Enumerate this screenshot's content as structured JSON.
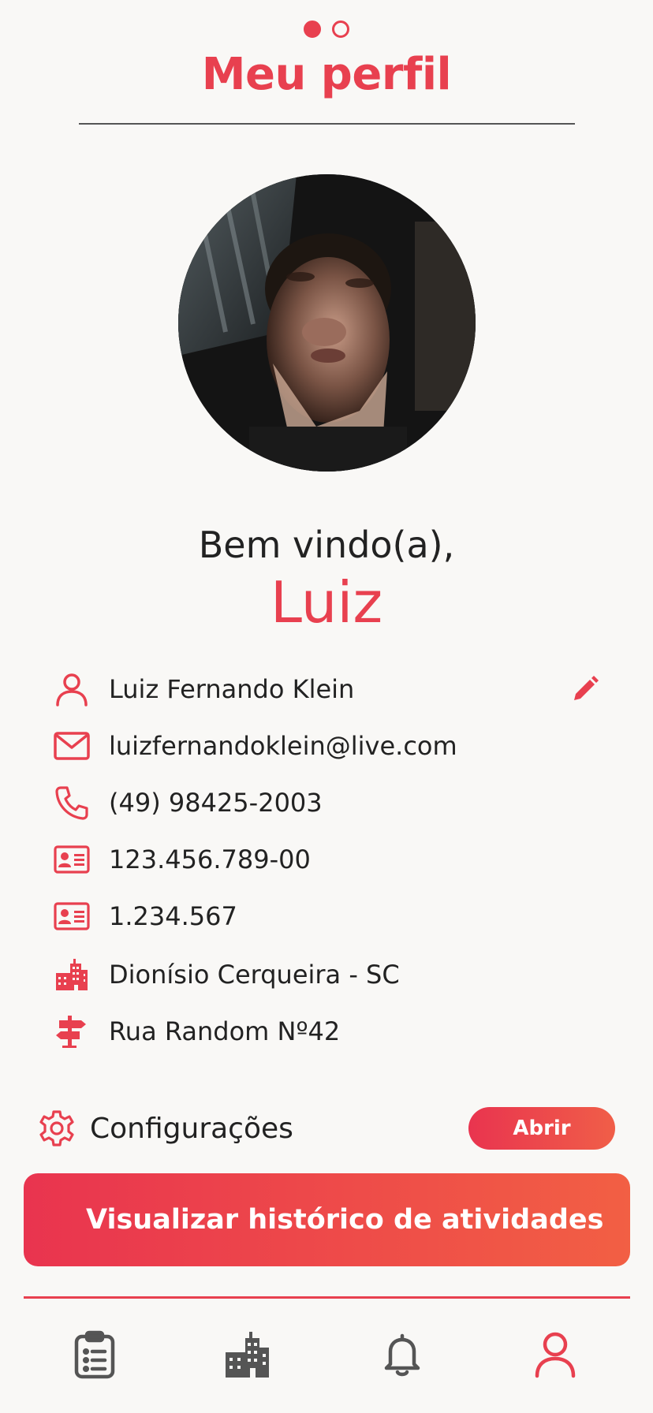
{
  "header": {
    "title": "Meu perfil",
    "page_indicator": {
      "total": 2,
      "active": 1
    }
  },
  "profile": {
    "welcome": "Bem vindo(a),",
    "first_name": "Luiz"
  },
  "info": {
    "full_name": "Luiz Fernando Klein",
    "email": "luizfernandoklein@live.com",
    "phone": "(49) 98425-2003",
    "cpf": "123.456.789-00",
    "rg": "1.234.567",
    "city": "Dionísio Cerqueira - SC",
    "address": "Rua Random Nº42"
  },
  "settings": {
    "label": "Configurações",
    "button": "Abrir"
  },
  "actions": {
    "history_button": "Visualizar histórico de atividades"
  },
  "bottom_nav": {
    "items": [
      "clipboard-list-icon",
      "city-icon",
      "bell-icon",
      "user-icon"
    ],
    "active": "user-icon"
  },
  "colors": {
    "accent": "#e8404f",
    "gradient_end": "#f25f44",
    "background": "#f9f8f6",
    "nav_inactive": "#555555"
  }
}
